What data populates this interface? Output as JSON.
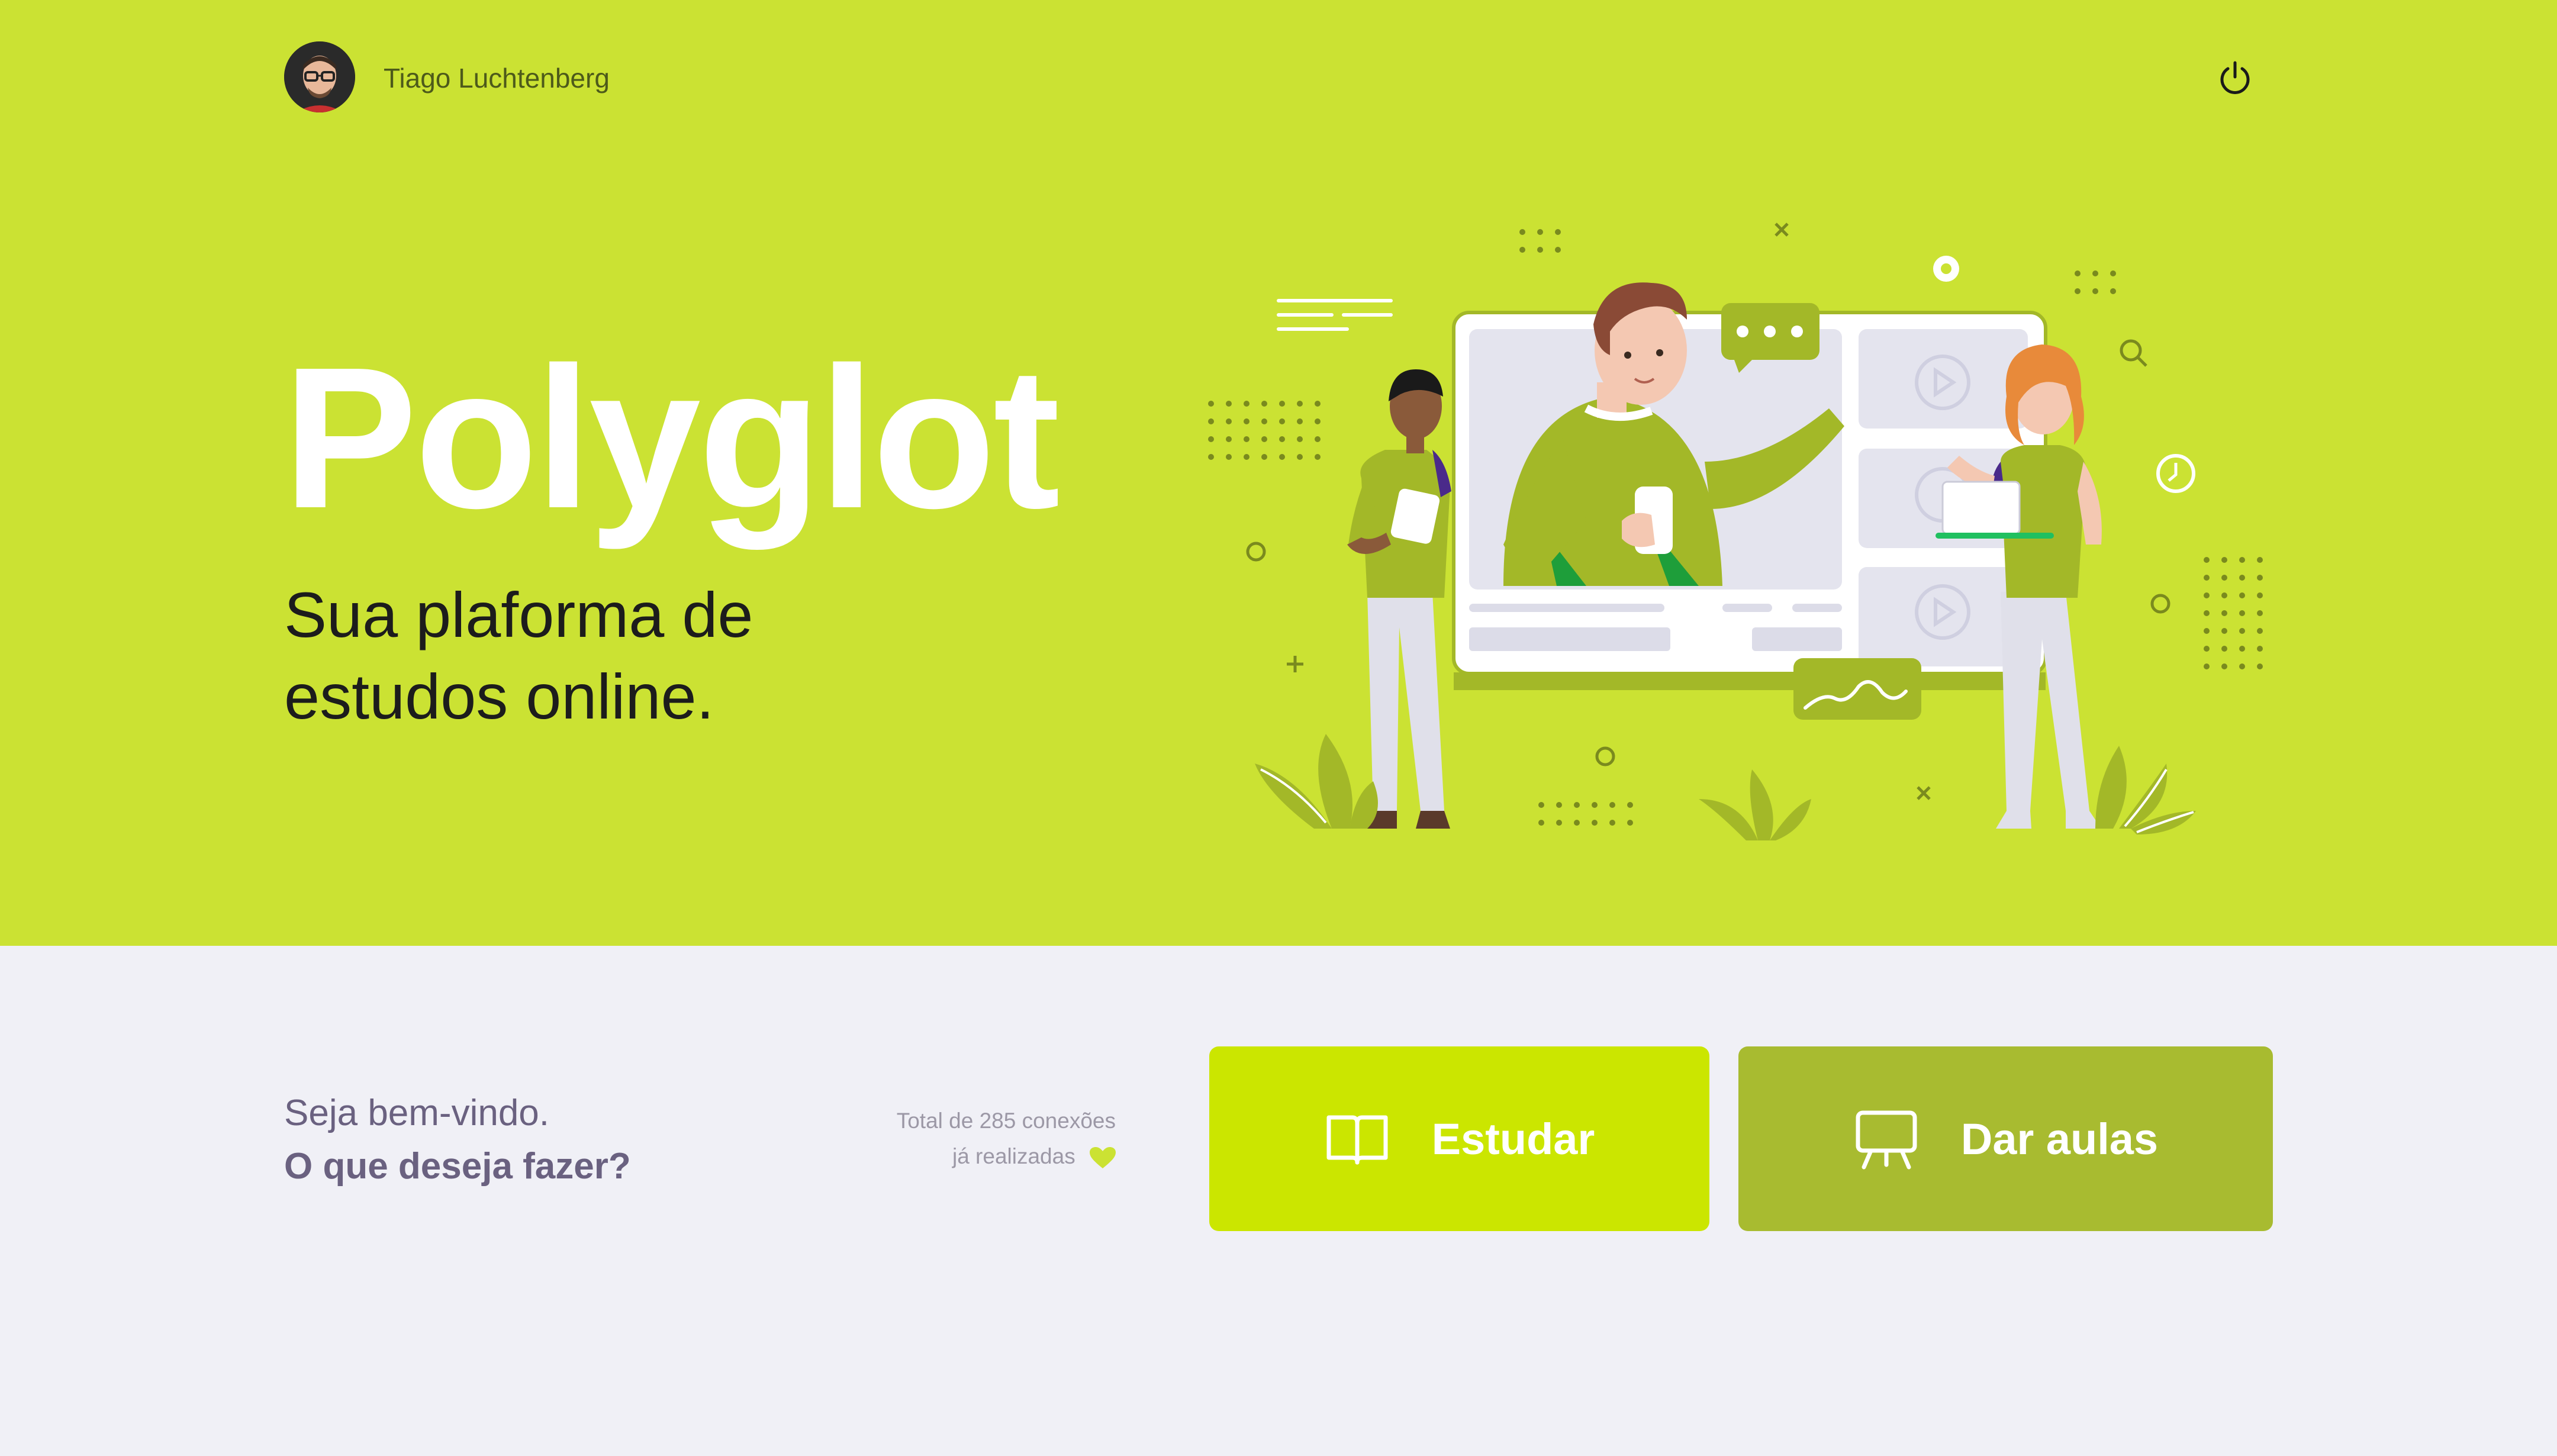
{
  "header": {
    "user_name": "Tiago Luchtenberg",
    "avatar_icon": "user-avatar",
    "logout_icon": "power-icon"
  },
  "hero": {
    "title": "Polyglot",
    "subtitle": "Sua plaforma de estudos online.",
    "illustration": "online-class-illustration"
  },
  "welcome": {
    "line1": "Seja bem-vindo.",
    "line2": "O que deseja fazer?"
  },
  "connections": {
    "line1": "Total de 285 conexões",
    "line2": "já realizadas",
    "icon": "heart-icon"
  },
  "actions": {
    "study_label": "Estudar",
    "study_icon": "book-icon",
    "teach_label": "Dar aulas",
    "teach_icon": "presentation-icon"
  },
  "colors": {
    "hero_bg": "#cbe233",
    "page_bg": "#f0f0f6",
    "study_button": "#cbe600",
    "teach_button": "#a8bb30",
    "heart": "#cbe233"
  }
}
